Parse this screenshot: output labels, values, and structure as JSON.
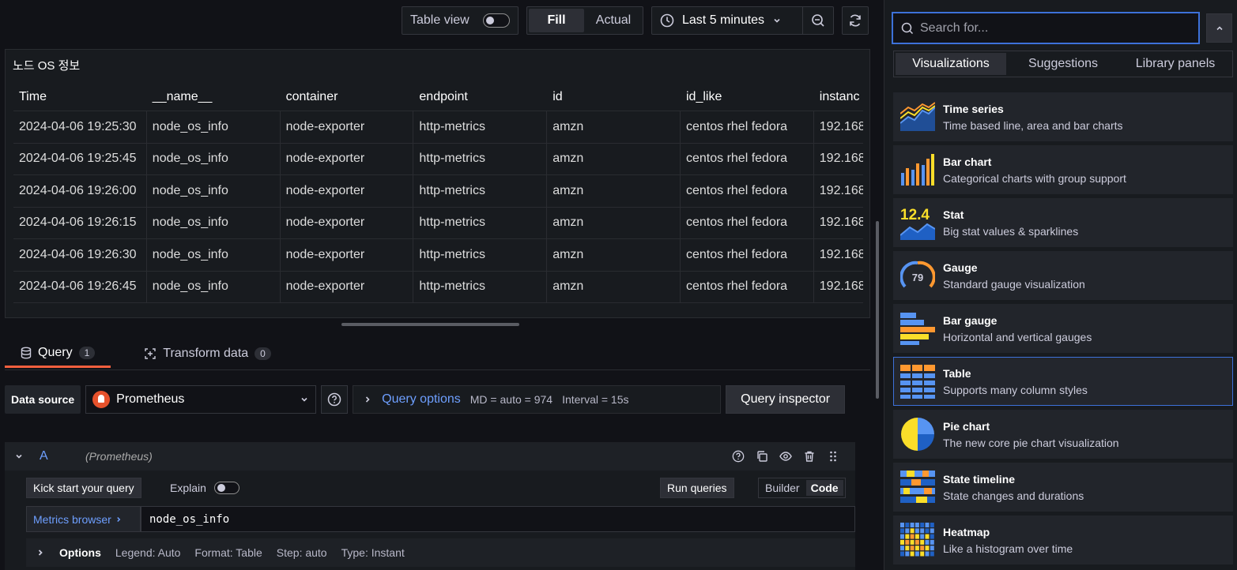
{
  "toolbar": {
    "table_view_label": "Table view",
    "fill_label": "Fill",
    "actual_label": "Actual",
    "time_range": "Last 5 minutes"
  },
  "panel": {
    "title": "노드 OS 정보",
    "columns": [
      "Time",
      "__name__",
      "container",
      "endpoint",
      "id",
      "id_like",
      "instanc"
    ],
    "rows": [
      [
        "2024-04-06 19:25:30",
        "node_os_info",
        "node-exporter",
        "http-metrics",
        "amzn",
        "centos rhel fedora",
        "192.168"
      ],
      [
        "2024-04-06 19:25:45",
        "node_os_info",
        "node-exporter",
        "http-metrics",
        "amzn",
        "centos rhel fedora",
        "192.168"
      ],
      [
        "2024-04-06 19:26:00",
        "node_os_info",
        "node-exporter",
        "http-metrics",
        "amzn",
        "centos rhel fedora",
        "192.168"
      ],
      [
        "2024-04-06 19:26:15",
        "node_os_info",
        "node-exporter",
        "http-metrics",
        "amzn",
        "centos rhel fedora",
        "192.168"
      ],
      [
        "2024-04-06 19:26:30",
        "node_os_info",
        "node-exporter",
        "http-metrics",
        "amzn",
        "centos rhel fedora",
        "192.168"
      ],
      [
        "2024-04-06 19:26:45",
        "node_os_info",
        "node-exporter",
        "http-metrics",
        "amzn",
        "centos rhel fedora",
        "192.168"
      ]
    ]
  },
  "query_tabs": [
    {
      "label": "Query",
      "count": "1"
    },
    {
      "label": "Transform data",
      "count": "0"
    }
  ],
  "datasource": {
    "label": "Data source",
    "name": "Prometheus",
    "query_options_label": "Query options",
    "md": "MD = auto = 974",
    "interval": "Interval = 15s",
    "inspector_label": "Query inspector"
  },
  "query": {
    "letter": "A",
    "source": "(Prometheus)",
    "kick_start": "Kick start your query",
    "explain": "Explain",
    "run": "Run queries",
    "builder": "Builder",
    "code": "Code",
    "metrics_browser": "Metrics browser",
    "expr": "node_os_info",
    "options_title": "Options",
    "legend": "Legend: Auto",
    "format": "Format: Table",
    "step": "Step: auto",
    "type": "Type: Instant"
  },
  "sidebar": {
    "search_placeholder": "Search for...",
    "tabs": [
      "Visualizations",
      "Suggestions",
      "Library panels"
    ],
    "visualizations": [
      {
        "name": "Time series",
        "desc": "Time based line, area and bar charts",
        "icon": "time-series-icon"
      },
      {
        "name": "Bar chart",
        "desc": "Categorical charts with group support",
        "icon": "bar-chart-icon"
      },
      {
        "name": "Stat",
        "desc": "Big stat values & sparklines",
        "icon": "stat-icon",
        "icon_value": "12.4"
      },
      {
        "name": "Gauge",
        "desc": "Standard gauge visualization",
        "icon": "gauge-icon",
        "icon_value": "79"
      },
      {
        "name": "Bar gauge",
        "desc": "Horizontal and vertical gauges",
        "icon": "bar-gauge-icon"
      },
      {
        "name": "Table",
        "desc": "Supports many column styles",
        "icon": "table-icon"
      },
      {
        "name": "Pie chart",
        "desc": "The new core pie chart visualization",
        "icon": "pie-chart-icon"
      },
      {
        "name": "State timeline",
        "desc": "State changes and durations",
        "icon": "state-timeline-icon"
      },
      {
        "name": "Heatmap",
        "desc": "Like a histogram over time",
        "icon": "heatmap-icon"
      }
    ]
  },
  "colors": {
    "accent_blue": "#3d71d9",
    "link_blue": "#6e9fff",
    "tab_underline": "#f55f3e",
    "viz_orange": "#ff9830",
    "viz_yellow": "#fade2a",
    "viz_blue": "#5794f2"
  }
}
